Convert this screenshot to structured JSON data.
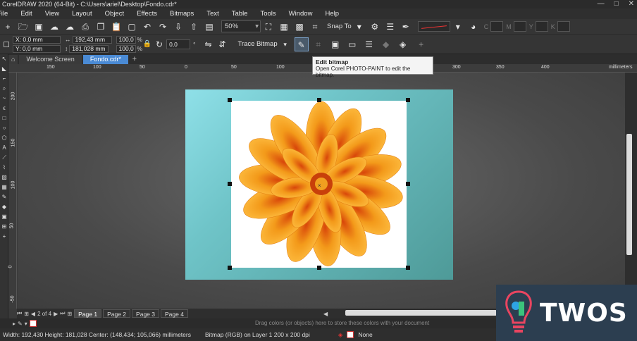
{
  "window": {
    "title": "CorelDRAW 2020 (64-Bit) - C:\\Users\\ariel\\Desktop\\Fondo.cdr*"
  },
  "menu": [
    "File",
    "Edit",
    "View",
    "Layout",
    "Object",
    "Effects",
    "Bitmaps",
    "Text",
    "Table",
    "Tools",
    "Window",
    "Help"
  ],
  "toolbar": {
    "zoom": "50%",
    "snap_label": "Snap To"
  },
  "props": {
    "x": "X: 0,0 mm",
    "y": "Y: 0,0 mm",
    "width": "192,43 mm",
    "height": "181,028 mm",
    "scale_x": "100,0",
    "scale_y": "100,0",
    "pct": "%",
    "angle": "0,0",
    "degree": "°",
    "trace_label": "Trace Bitmap"
  },
  "tabs": [
    {
      "label": "Welcome Screen"
    },
    {
      "label": "Fondo.cdr*"
    }
  ],
  "ruler": {
    "h": [
      "150",
      "100",
      "50",
      "0",
      "50",
      "100",
      "150",
      "200",
      "250",
      "300",
      "350",
      "400"
    ],
    "unit": "millimeters",
    "v": [
      "200",
      "150",
      "100",
      "50",
      "0",
      "-50"
    ]
  },
  "tooltip": {
    "title": "Edit bitmap",
    "desc": "Open Corel PHOTO-PAINT to edit the bitmap."
  },
  "pages": {
    "counter": "2 of 4",
    "tabs": [
      "Page 1",
      "Page 2",
      "Page 3",
      "Page 4"
    ]
  },
  "colorbar": {
    "hint": "Drag colors (or objects) here to store these colors with your document"
  },
  "status": {
    "dims": "Width: 192,430  Height: 181,028  Center: (148,434; 105,066)  millimeters",
    "object": "Bitmap (RGB) on Layer 1 200 x 200 dpi",
    "fill": "None"
  },
  "watermark": {
    "text": "TWOS"
  },
  "colors": {
    "accent": "#4a8ad4",
    "page_light": "#8fe0e8",
    "page_dark": "#4e9a98",
    "petal_orange": "#f39a1a",
    "petal_red": "#d8460a",
    "watermark_bg": "#2c3e50"
  }
}
